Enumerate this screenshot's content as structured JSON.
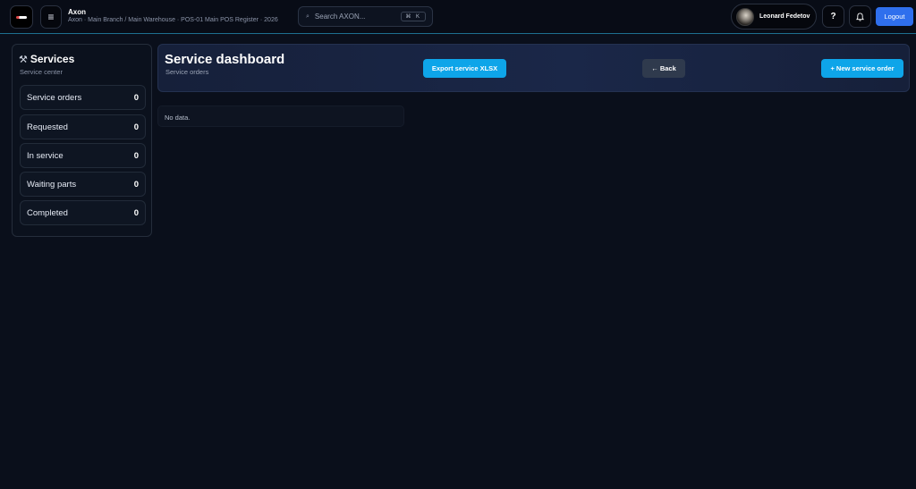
{
  "topbar": {
    "logo": "logo-icon",
    "menu_icon": "≡",
    "app_title": "Axon",
    "app_subtitle": "Axon · Main Branch / Main Warehouse · POS-01 Main POS Register · 2026",
    "search": {
      "icon": "⌕",
      "placeholder": "Search AXON...",
      "shortcut": "⌘ K"
    },
    "user": {
      "name": "Leonard Fedetov"
    },
    "help_label": "?",
    "bell_icon": "🔔",
    "logout_label": "Logout"
  },
  "sidebar": {
    "icon": "⚒",
    "title": "Services",
    "subtitle": "Service center",
    "items": [
      {
        "label": "Service orders",
        "count": "0"
      },
      {
        "label": "Requested",
        "count": "0"
      },
      {
        "label": "In service",
        "count": "0"
      },
      {
        "label": "Waiting parts",
        "count": "0"
      },
      {
        "label": "Completed",
        "count": "0"
      }
    ]
  },
  "header": {
    "title": "Service dashboard",
    "subtitle": "Service orders",
    "export_label": "Export service XLSX",
    "back_label": "← Back",
    "new_label": "+ New service order"
  },
  "content": {
    "empty_text": "No data."
  },
  "colors": {
    "background": "#0a0f1b",
    "accent": "#0ea5e9",
    "logout": "#2f6fed"
  }
}
